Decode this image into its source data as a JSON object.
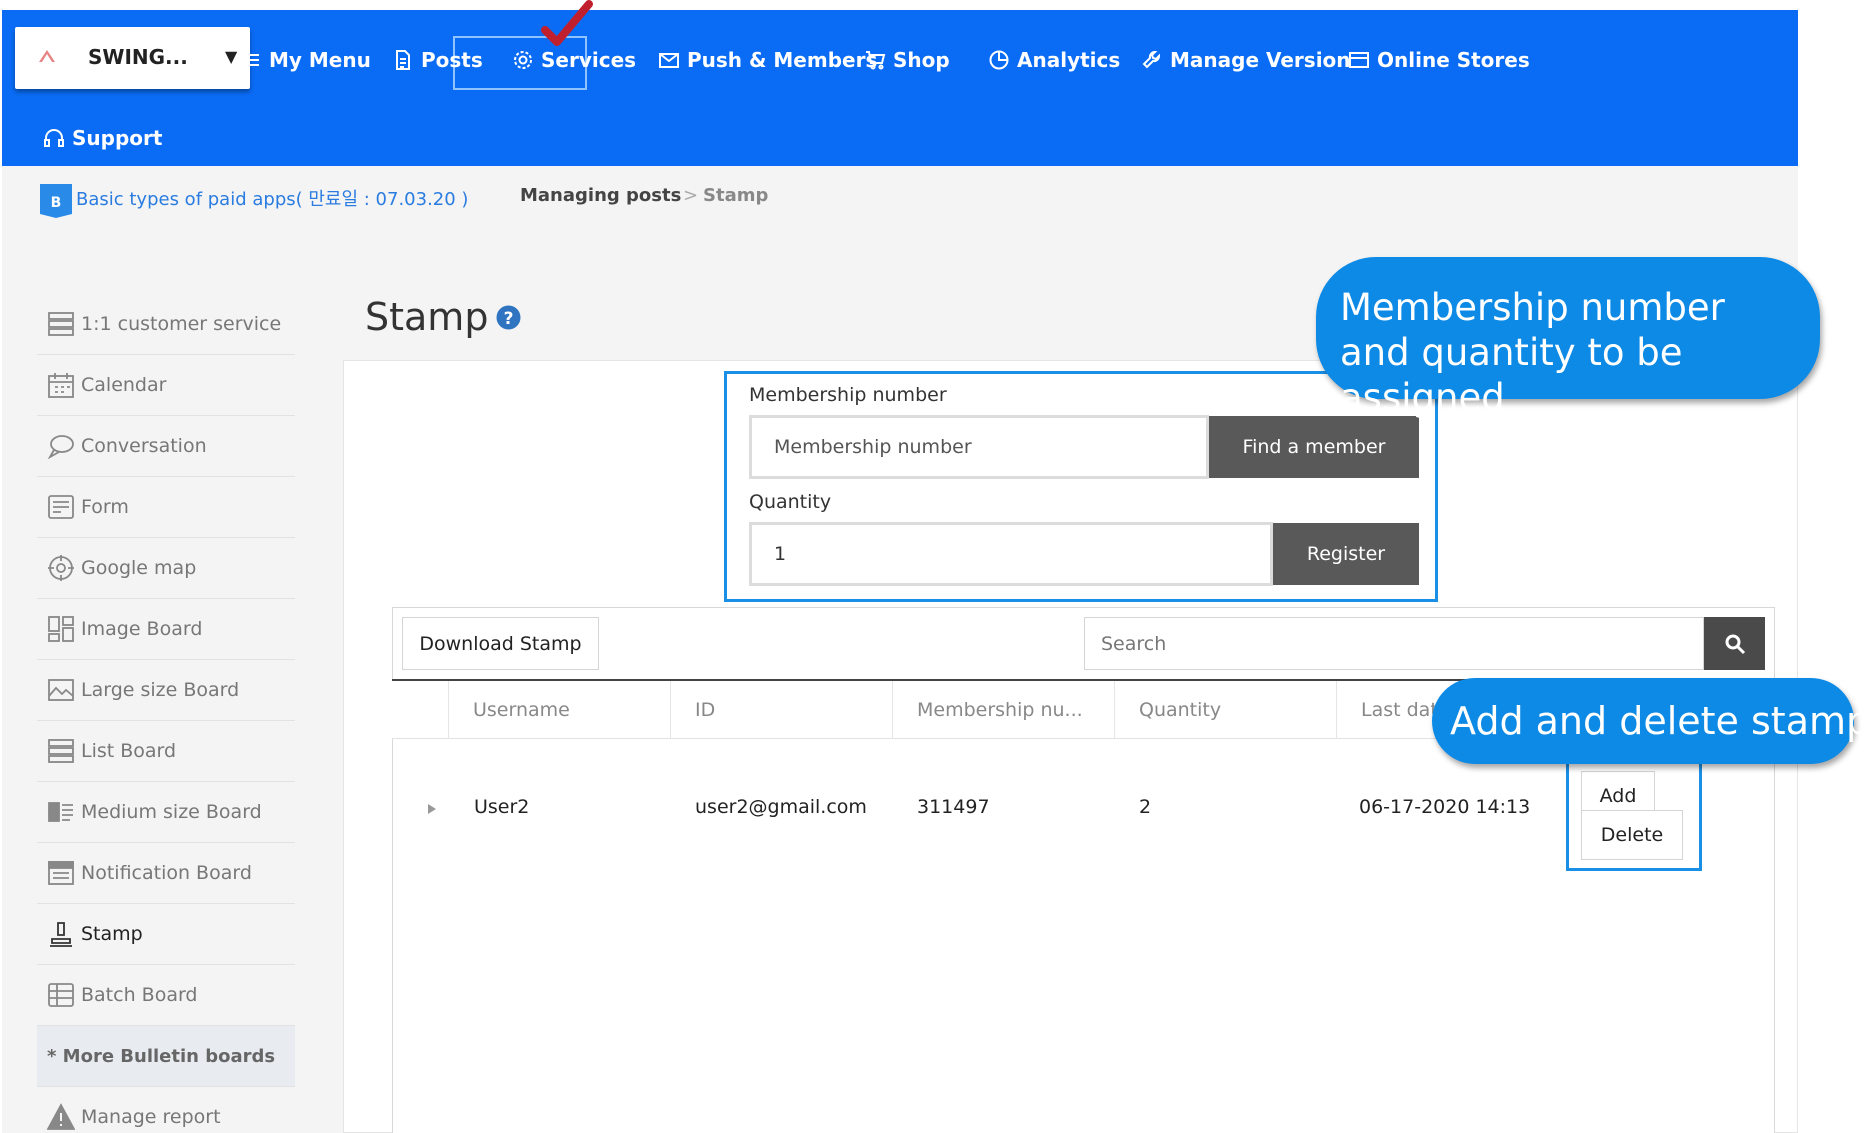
{
  "app_selector": {
    "name": "SWING...",
    "caret": "▼"
  },
  "nav": {
    "my_menu": "My Menu",
    "posts": "Posts",
    "services": "Services",
    "push_members": "Push & Members",
    "shop": "Shop",
    "analytics": "Analytics",
    "manage_version": "Manage Version",
    "online_stores": "Online Stores",
    "support": "Support"
  },
  "breadcrumb": {
    "badge": "B",
    "app_link": "Basic types of paid apps( 만료일 : 07.03.20 )",
    "section": "Managing posts",
    "separator": ">",
    "current": "Stamp"
  },
  "sidebar": {
    "items": [
      {
        "label": "1:1 customer service",
        "icon": "list-icon"
      },
      {
        "label": "Calendar",
        "icon": "calendar-icon"
      },
      {
        "label": "Conversation",
        "icon": "chat-bubble-icon"
      },
      {
        "label": "Form",
        "icon": "form-icon"
      },
      {
        "label": "Google map",
        "icon": "map-target-icon"
      },
      {
        "label": "Image Board",
        "icon": "image-board-icon"
      },
      {
        "label": "Large size Board",
        "icon": "picture-icon"
      },
      {
        "label": "List Board",
        "icon": "list-icon"
      },
      {
        "label": "Medium size Board",
        "icon": "medium-board-icon"
      },
      {
        "label": "Notification Board",
        "icon": "notification-board-icon"
      },
      {
        "label": "Stamp",
        "icon": "stamp-icon"
      },
      {
        "label": "Batch Board",
        "icon": "batch-board-icon"
      },
      {
        "label": "* More Bulletin boards",
        "icon": ""
      },
      {
        "label": "Manage report",
        "icon": "warning-icon"
      }
    ]
  },
  "page": {
    "title": "Stamp",
    "help": "?"
  },
  "form": {
    "membership_label": "Membership number",
    "membership_placeholder": "Membership number",
    "find_member": "Find a member",
    "quantity_label": "Quantity",
    "quantity_value": "1",
    "register": "Register"
  },
  "list": {
    "download": "Download Stamp",
    "search_placeholder": "Search",
    "columns": [
      "Username",
      "ID",
      "Membership nu...",
      "Quantity",
      "Last dat"
    ],
    "rows": [
      {
        "username": "User2",
        "id": "user2@gmail.com",
        "membership": "311497",
        "quantity": "2",
        "last_date": "06-17-2020 14:13"
      }
    ],
    "add": "Add",
    "delete": "Delete"
  },
  "callouts": {
    "membership": "Membership number and quantity to be assigned",
    "add_delete": "Add and delete stamp"
  },
  "colors": {
    "nav_bg": "#0a6cf5",
    "callout": "#0d8ae6",
    "highlight_border": "#1a8fe6",
    "dark_button": "#595959",
    "checkmark": "#c0202e"
  }
}
